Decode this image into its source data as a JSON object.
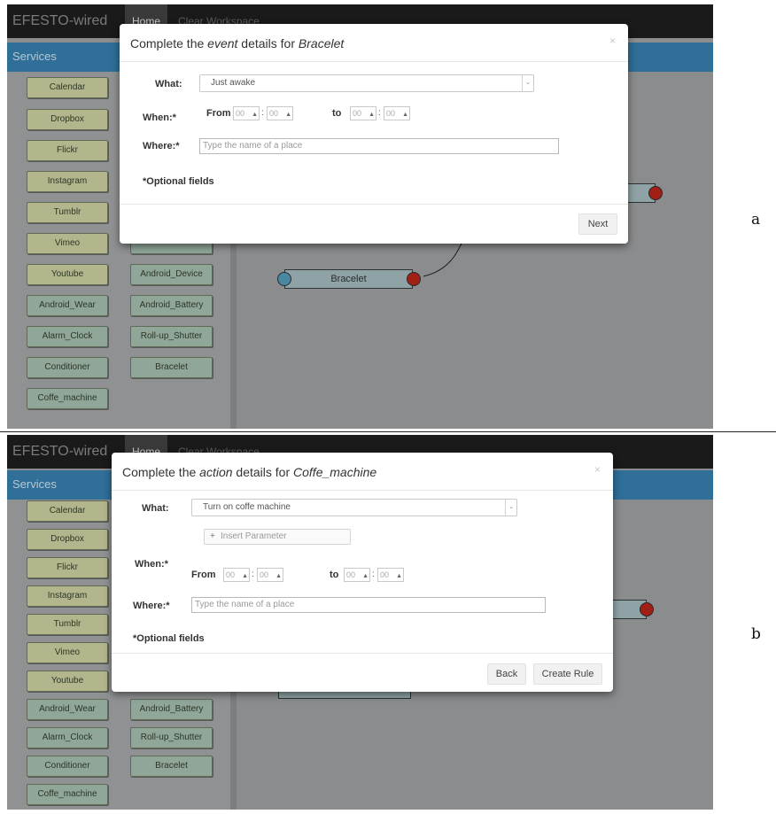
{
  "panels": [
    {
      "letter": "a",
      "brand": "EFESTO-wired",
      "nav": [
        "Home",
        "Clear Workspace"
      ],
      "services_title": "Services",
      "col1": [
        "Calendar",
        "Dropbox",
        "Flickr",
        "Instagram",
        "Tumblr",
        "Vimeo",
        "Youtube",
        "Android_Wear",
        "Alarm_Clock",
        "Conditioner",
        "Coffe_machine"
      ],
      "col2": [
        "Android_Device",
        "Android_Battery",
        "Roll-up_Shutter",
        "Bracelet"
      ],
      "node_label": "Bracelet",
      "modal": {
        "title_pre": "Complete the ",
        "title_em": "event",
        "title_mid": " details for ",
        "title_obj": "Bracelet",
        "close": "×",
        "what_label": "What:",
        "what_value": "Just awake",
        "when_label": "When:*",
        "from_label": "From",
        "to_label": "to",
        "time_placeholder": "00",
        "where_label": "Where:*",
        "where_placeholder": "Type the name of a place",
        "optional": "*Optional fields",
        "next": "Next"
      }
    },
    {
      "letter": "b",
      "brand": "EFESTO-wired",
      "nav": [
        "Home",
        "Clear Workspace"
      ],
      "services_title": "Services",
      "col1": [
        "Calendar",
        "Dropbox",
        "Flickr",
        "Instagram",
        "Tumblr",
        "Vimeo",
        "Youtube",
        "Android_Wear",
        "Alarm_Clock",
        "Conditioner",
        "Coffe_machine"
      ],
      "col2": [
        "Android_Battery",
        "Roll-up_Shutter",
        "Bracelet"
      ],
      "modal": {
        "title_pre": "Complete the ",
        "title_em": "action",
        "title_mid": " details for ",
        "title_obj": "Coffe_machine",
        "close": "×",
        "what_label": "What:",
        "what_value": "Turn on coffe machine",
        "param_plus": "+",
        "param_label": "Insert Parameter",
        "when_label": "When:*",
        "from_label": "From",
        "to_label": "to",
        "time_placeholder": "00",
        "where_label": "Where:*",
        "where_placeholder": "Type the name of a place",
        "optional": "*Optional fields",
        "back": "Back",
        "create": "Create Rule"
      }
    }
  ],
  "colors": {
    "navbar": "#1a1a1a",
    "services_bar": "#2f6f98",
    "service_button_yellow": "#b3b68d",
    "service_button_teal": "#8fa699",
    "node_red_port": "#a11f14",
    "node_blue_port": "#4a87a3"
  }
}
